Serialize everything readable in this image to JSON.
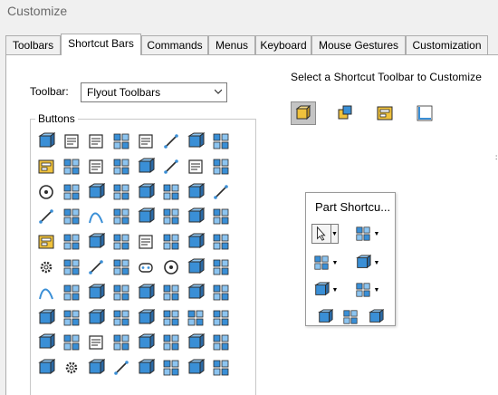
{
  "window": {
    "title": "Customize"
  },
  "tabs": [
    {
      "label": "Toolbars",
      "active": false
    },
    {
      "label": "Shortcut Bars",
      "active": true
    },
    {
      "label": "Commands",
      "active": false
    },
    {
      "label": "Menus",
      "active": false
    },
    {
      "label": "Keyboard",
      "active": false
    },
    {
      "label": "Mouse Gestures",
      "active": false
    },
    {
      "label": "Customization",
      "active": false
    }
  ],
  "toolbar_select": {
    "label": "Toolbar:",
    "value": "Flyout Toolbars"
  },
  "buttons_group": {
    "label": "Buttons",
    "rows": [
      [
        "sketch-icon",
        "text-format-icon",
        "annotation-text-icon",
        "part-icon",
        "image-text-icon",
        "spline-icon",
        "reference-geometry-icon",
        "crosshair-icon"
      ],
      [
        "view-layout-icon",
        "hand-icon",
        "document-icon",
        "table-icon",
        "shear-icon",
        "line-style-icon",
        "document-print-icon",
        "rotate-view-icon"
      ],
      [
        "target-icon",
        "flag-icon",
        "color-wheel-icon",
        "picture-icon",
        "filter-icon",
        "frame-icon",
        "assembly-icon",
        "line-corner-icon"
      ],
      [
        "pencil-icon",
        "red-cube-icon",
        "curve-icon",
        "clipboard-icon",
        "feature-icon",
        "grid-part-icon",
        "diamond-icon",
        "table-grid-icon"
      ],
      [
        "toolbox-icon",
        "zoom-icon",
        "globe-icon",
        "cursor-part-icon",
        "blank-page-icon",
        "folder-check-icon",
        "save-icon",
        "printer-icon"
      ],
      [
        "gear-icon",
        "corner-icon",
        "line-icon",
        "rect-icon",
        "slot-icon",
        "circle-icon",
        "arc-icon",
        "ellipse-icon"
      ],
      [
        "wave-icon",
        "fillet-icon",
        "box-icon",
        "pattern-icon",
        "arrows-icon",
        "mirror-icon",
        "eye-icon",
        "trim-icon"
      ],
      [
        "extrude-icon",
        "revolve-icon",
        "sweep-icon",
        "loft-icon",
        "shell-icon",
        "rib-icon",
        "mirror-feature-icon",
        "move-icon"
      ],
      [
        "scale-icon",
        "swap-icon",
        "text-aaa-icon",
        "monitor-icon",
        "check-list-icon",
        "key-icon",
        "cube-lit-icon",
        "stack-icon"
      ],
      [
        "part-blue-icon",
        "part-gear-icon",
        "dimension-icon",
        "pen-icon",
        "measure-icon",
        "ruler-icon",
        "multi-body-icon",
        "gray-parts-icon"
      ]
    ]
  },
  "shortcut_section": {
    "label": "Select a Shortcut Toolbar to Customize",
    "buttons": [
      "part-shortcut-icon",
      "assembly-shortcut-icon",
      "drawing-shortcut-icon",
      "sketch-shortcut-icon"
    ]
  },
  "popup": {
    "title": "Part Shortcu...",
    "rows": [
      [
        "select-arrow-icon",
        "view-cube-icon"
      ],
      [
        "normal-to-icon",
        "isometric-icon"
      ],
      [
        "flag-icon",
        "sketch-plane-icon"
      ],
      [
        "extrude-icon",
        "solid-cube-icon",
        "section-view-icon"
      ]
    ]
  },
  "colors": {
    "accent": "#1e88e5",
    "icon_yellow": "#f0c23c",
    "icon_blue": "#3a8fd6",
    "icon_dark": "#2b2b2b"
  }
}
